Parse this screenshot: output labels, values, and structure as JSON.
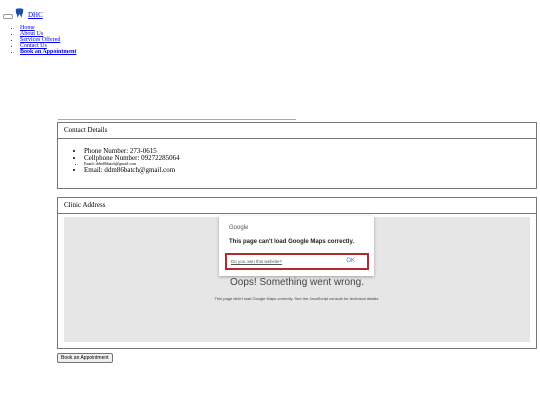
{
  "brand": {
    "name": "DHC"
  },
  "nav": [
    {
      "label": "Home"
    },
    {
      "label": "About Us"
    },
    {
      "label": "Services Offered"
    },
    {
      "label": "Contact Us"
    },
    {
      "label": "Book an Appointment"
    }
  ],
  "contact": {
    "title": "Contact Details",
    "phone": "Phone Number: 273-0615",
    "cellphone": "Cellphone Number: 09272285064",
    "email_small": "Email: ddm86batch@gmail.com",
    "email": "Email: ddm86batch@gmail.com"
  },
  "clinic": {
    "title": "Clinic Address",
    "map_error_title": "Oops! Something went wrong.",
    "map_error_detail": "This page didn't load Google Maps correctly. See the JavaScript console for technical details.",
    "dialog": {
      "logo": "Google",
      "message": "This page can't load Google Maps correctly.",
      "own_site_link": "Do you own this website?",
      "ok_label": "OK"
    }
  },
  "book_button": {
    "label": "Book an Appointment"
  },
  "colors": {
    "link": "#0000ee",
    "highlight_border": "#b5282c",
    "map_bg": "#e6e6e6",
    "ok_blue": "#3b78e7"
  }
}
